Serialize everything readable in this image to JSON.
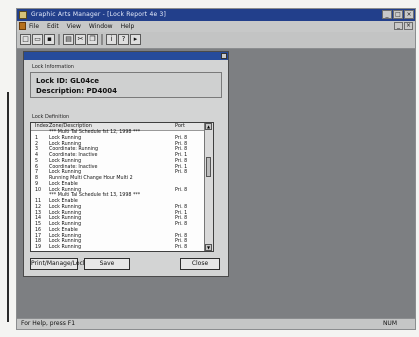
{
  "window": {
    "title": "Graphic Arts Manager - [Lock Report 4e 3]",
    "controls": [
      "_",
      "□",
      "×"
    ]
  },
  "menubar": {
    "items": [
      "File",
      "Edit",
      "View",
      "Window",
      "Help"
    ],
    "mdi_controls": [
      "_",
      "×"
    ]
  },
  "toolbar": {
    "buttons": [
      {
        "icon": "new-icon",
        "glyph": "□"
      },
      {
        "icon": "open-icon",
        "glyph": "▭"
      },
      {
        "icon": "save-icon",
        "glyph": "▪"
      },
      {
        "icon": "print-icon",
        "glyph": "▤"
      },
      {
        "icon": "cut-icon",
        "glyph": "✂"
      },
      {
        "icon": "copy-icon",
        "glyph": "❐"
      },
      {
        "icon": "info-icon",
        "glyph": "i"
      },
      {
        "icon": "help-icon",
        "glyph": "?"
      },
      {
        "icon": "cursor-help-icon",
        "glyph": "▸"
      }
    ]
  },
  "child_window": {
    "group1_label": "Lock Information",
    "lock_id": "Lock ID: GL04ce",
    "description": "Description: PD4004",
    "group2_label": "Lock Definition",
    "list_headers": [
      "Index",
      "Zone/Description",
      "Port"
    ],
    "rows": [
      {
        "idx": "",
        "desc": "*** Multi Tal Schedule fst 12, 1998 ***",
        "port": ""
      },
      {
        "idx": "1",
        "desc": "Lock Running",
        "port": "Pri. 8"
      },
      {
        "idx": "2",
        "desc": "Lock Running",
        "port": "Pri. 8"
      },
      {
        "idx": "3",
        "desc": "Coordinate: Running",
        "port": "Pri. 8"
      },
      {
        "idx": "4",
        "desc": "Coordinate: Inactive",
        "port": "Pri. 1"
      },
      {
        "idx": "5",
        "desc": "Lock Running",
        "port": "Pri. 8"
      },
      {
        "idx": "6",
        "desc": "Coordinate: Inactive",
        "port": "Pri. 1"
      },
      {
        "idx": "7",
        "desc": "Lock Running",
        "port": "Pri. 8"
      },
      {
        "idx": "8",
        "desc": "Running Multi Change Hour Multi 2",
        "port": ""
      },
      {
        "idx": "9",
        "desc": "Lock Enable",
        "port": ""
      },
      {
        "idx": "10",
        "desc": "Lock Running",
        "port": "Pri. 8"
      },
      {
        "idx": "",
        "desc": "*** Multi Tal Schedule fst 13, 1998 ***",
        "port": ""
      },
      {
        "idx": "11",
        "desc": "Lock Enable",
        "port": ""
      },
      {
        "idx": "12",
        "desc": "Lock Running",
        "port": "Pri. 8"
      },
      {
        "idx": "13",
        "desc": "Lock Running",
        "port": "Pri. 1"
      },
      {
        "idx": "14",
        "desc": "Lock Running",
        "port": "Pri. 8"
      },
      {
        "idx": "15",
        "desc": "Lock Running",
        "port": "Pri. 8"
      },
      {
        "idx": "16",
        "desc": "Lock Enable",
        "port": ""
      },
      {
        "idx": "17",
        "desc": "Lock Running",
        "port": "Pri. 8"
      },
      {
        "idx": "18",
        "desc": "Lock Running",
        "port": "Pri. 8"
      },
      {
        "idx": "19",
        "desc": "Lock Running",
        "port": "Pri. 8"
      }
    ],
    "buttons": {
      "print_lock": "Print/Manage/Lock",
      "save": "Save",
      "close": "Close"
    }
  },
  "statusbar": {
    "left": "For Help, press F1",
    "right": "NUM"
  }
}
